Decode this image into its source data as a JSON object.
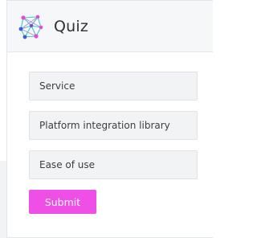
{
  "header": {
    "title": "Quiz",
    "logo_icon": "network-graph-icon"
  },
  "options": [
    {
      "label": "Service"
    },
    {
      "label": "Platform integration library"
    },
    {
      "label": "Ease of use"
    }
  ],
  "actions": {
    "submit_label": "Submit"
  },
  "colors": {
    "accent": "#ef4fe6",
    "header_bg": "#f6f7f9",
    "option_bg": "#f2f3f5",
    "logo_node_pink": "#e84ad8",
    "logo_node_blue": "#3a5bd9",
    "logo_line_teal": "#46c8c0"
  }
}
